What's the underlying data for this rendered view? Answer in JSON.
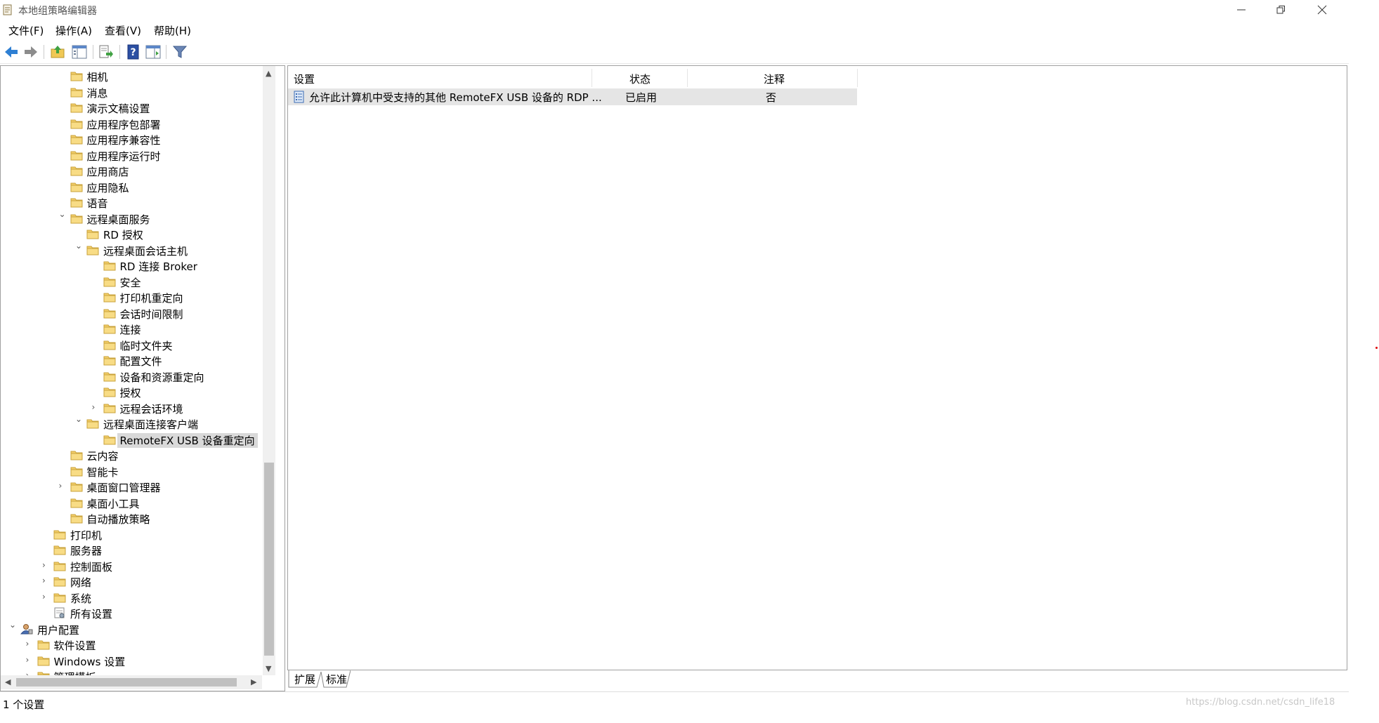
{
  "window": {
    "title": "本地组策略编辑器"
  },
  "menu": [
    "文件(F)",
    "操作(A)",
    "查看(V)",
    "帮助(H)"
  ],
  "tree": [
    {
      "label": "相机",
      "depth": 3,
      "twisty": ""
    },
    {
      "label": "消息",
      "depth": 3,
      "twisty": ""
    },
    {
      "label": "演示文稿设置",
      "depth": 3,
      "twisty": ""
    },
    {
      "label": "应用程序包部署",
      "depth": 3,
      "twisty": ""
    },
    {
      "label": "应用程序兼容性",
      "depth": 3,
      "twisty": ""
    },
    {
      "label": "应用程序运行时",
      "depth": 3,
      "twisty": ""
    },
    {
      "label": "应用商店",
      "depth": 3,
      "twisty": ""
    },
    {
      "label": "应用隐私",
      "depth": 3,
      "twisty": ""
    },
    {
      "label": "语音",
      "depth": 3,
      "twisty": ""
    },
    {
      "label": "远程桌面服务",
      "depth": 3,
      "twisty": "expanded"
    },
    {
      "label": "RD 授权",
      "depth": 4,
      "twisty": ""
    },
    {
      "label": "远程桌面会话主机",
      "depth": 4,
      "twisty": "expanded"
    },
    {
      "label": "RD 连接 Broker",
      "depth": 5,
      "twisty": ""
    },
    {
      "label": "安全",
      "depth": 5,
      "twisty": ""
    },
    {
      "label": "打印机重定向",
      "depth": 5,
      "twisty": ""
    },
    {
      "label": "会话时间限制",
      "depth": 5,
      "twisty": ""
    },
    {
      "label": "连接",
      "depth": 5,
      "twisty": ""
    },
    {
      "label": "临时文件夹",
      "depth": 5,
      "twisty": ""
    },
    {
      "label": "配置文件",
      "depth": 5,
      "twisty": ""
    },
    {
      "label": "设备和资源重定向",
      "depth": 5,
      "twisty": ""
    },
    {
      "label": "授权",
      "depth": 5,
      "twisty": ""
    },
    {
      "label": "远程会话环境",
      "depth": 5,
      "twisty": "collapsed"
    },
    {
      "label": "远程桌面连接客户端",
      "depth": 4,
      "twisty": "expanded"
    },
    {
      "label": "RemoteFX USB 设备重定向",
      "depth": 5,
      "twisty": "",
      "selected": true
    },
    {
      "label": "云内容",
      "depth": 3,
      "twisty": ""
    },
    {
      "label": "智能卡",
      "depth": 3,
      "twisty": ""
    },
    {
      "label": "桌面窗口管理器",
      "depth": 3,
      "twisty": "collapsed"
    },
    {
      "label": "桌面小工具",
      "depth": 3,
      "twisty": ""
    },
    {
      "label": "自动播放策略",
      "depth": 3,
      "twisty": ""
    },
    {
      "label": "打印机",
      "depth": 2,
      "twisty": ""
    },
    {
      "label": "服务器",
      "depth": 2,
      "twisty": ""
    },
    {
      "label": "控制面板",
      "depth": 2,
      "twisty": "collapsed"
    },
    {
      "label": "网络",
      "depth": 2,
      "twisty": "collapsed"
    },
    {
      "label": "系统",
      "depth": 2,
      "twisty": "collapsed"
    },
    {
      "label": "所有设置",
      "depth": 2,
      "twisty": "",
      "icon": "settings-list"
    },
    {
      "label": "用户配置",
      "depth": 0,
      "twisty": "expanded",
      "icon": "user-config"
    },
    {
      "label": "软件设置",
      "depth": 1,
      "twisty": "collapsed"
    },
    {
      "label": "Windows 设置",
      "depth": 1,
      "twisty": "collapsed"
    },
    {
      "label": "管理模板",
      "depth": 1,
      "twisty": "collapsed"
    }
  ],
  "list": {
    "columns": [
      "设置",
      "状态",
      "注释"
    ],
    "rows": [
      {
        "setting": "允许此计算机中受支持的其他 RemoteFX USB 设备的 RDP ...",
        "state": "已启用",
        "comment": "否"
      }
    ]
  },
  "tabs": [
    "扩展",
    "标准"
  ],
  "status": "1 个设置",
  "watermark": "https://blog.csdn.net/csdn_life18",
  "colors": {
    "folder": "#f0c855",
    "selection": "#d9d9d9",
    "row_highlight": "#e5e5e5"
  }
}
